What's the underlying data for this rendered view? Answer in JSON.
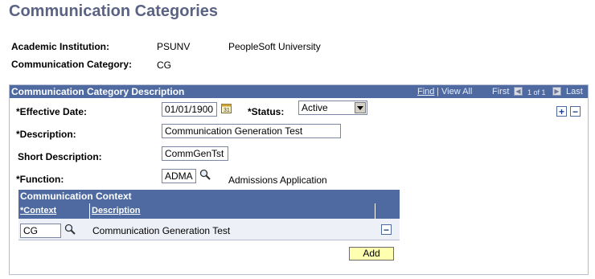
{
  "page": {
    "title": "Communication Categories"
  },
  "header_fields": {
    "institution_label": "Academic Institution:",
    "institution_code": "PSUNV",
    "institution_name": "PeopleSoft University",
    "category_label": "Communication Category:",
    "category_code": "CG"
  },
  "panel": {
    "title": "Communication Category Description",
    "nav": {
      "find": "Find",
      "separator": "|",
      "view_all": "View All",
      "first": "First",
      "count": "1 of 1",
      "last": "Last"
    },
    "effective_date": {
      "label": "*Effective Date:",
      "value": "01/01/1900"
    },
    "status": {
      "label": "*Status:",
      "value": "Active"
    },
    "description": {
      "label": "*Description:",
      "value": "Communication Generation Test"
    },
    "short_description": {
      "label": "Short Description:",
      "value": "CommGenTst"
    },
    "function": {
      "label": "*Function:",
      "value": "ADMA",
      "description": "Admissions Application"
    }
  },
  "context_grid": {
    "title": "Communication Context",
    "columns": [
      "*Context",
      "Description"
    ],
    "rows": [
      {
        "context": "CG",
        "description": "Communication Generation Test"
      }
    ],
    "add_label": "Add"
  },
  "colors": {
    "title": "#5a6384",
    "header_bar": "#4e6aa0",
    "add_button": "#ffffb0"
  }
}
